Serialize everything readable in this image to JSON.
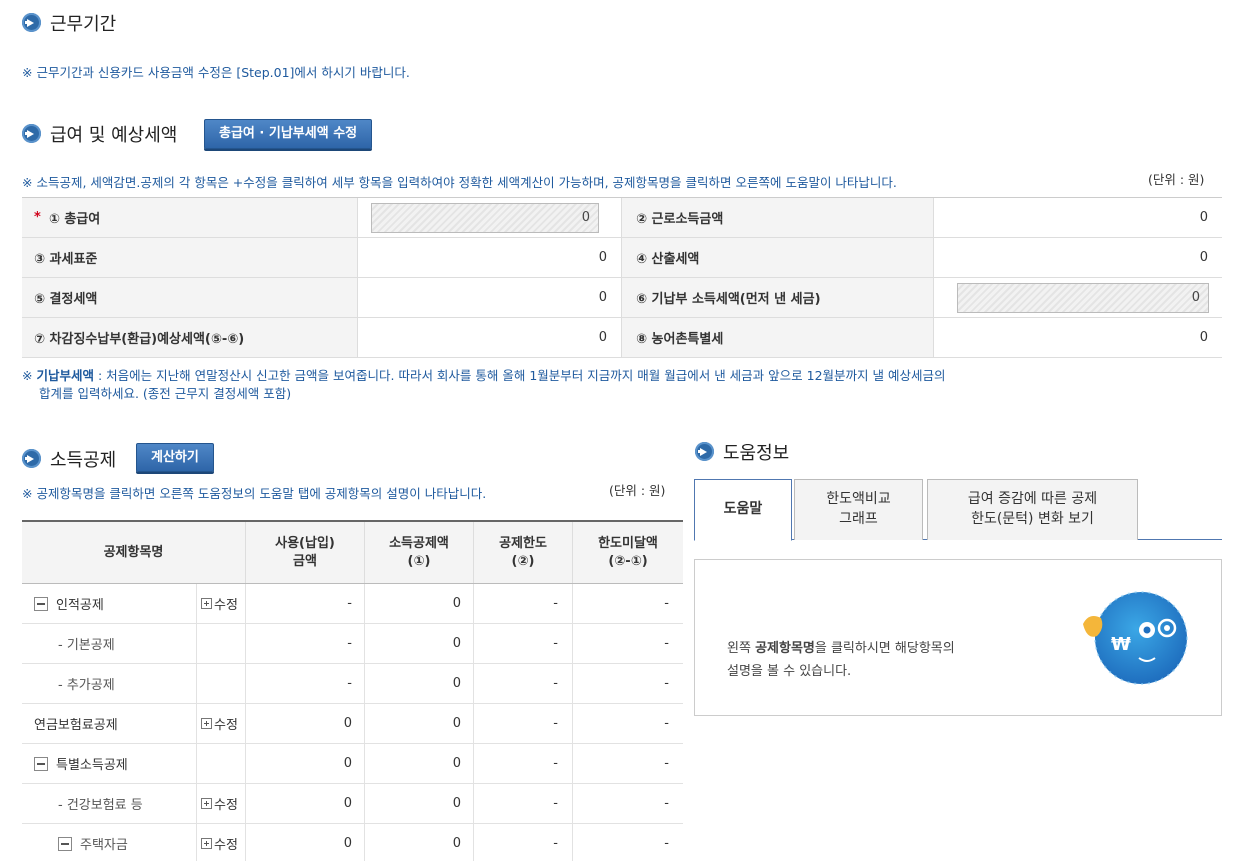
{
  "section1": {
    "title": "근무기간",
    "note": "※ 근무기간과 신용카드 사용금액 수정은 [Step.01]에서 하시기 바랍니다."
  },
  "section2": {
    "title": "급여 및 예상세액",
    "button": "총급여 · 기납부세액 수정",
    "note": "※ 소득공제, 세액감면.공제의 각 항목은 +수정을 클릭하여 세부 항목을 입력하여야 정확한 세액계산이 가능하며, 공제항목명을 클릭하면 오른쪽에 도움말이 나타납니다.",
    "unit": "(단위 : 원)",
    "rows": [
      {
        "l1": "① 총급여",
        "v1": "0",
        "l2": "② 근로소득금액",
        "v2": "0"
      },
      {
        "l1": "③ 과세표준",
        "v1": "0",
        "l2": "④ 산출세액",
        "v2": "0"
      },
      {
        "l1": "⑤ 결정세액",
        "v1": "0",
        "l2": "⑥ 기납부 소득세액(먼저 낸 세금)",
        "v2": "0"
      },
      {
        "l1": "⑦ 차감징수납부(환급)예상세액(⑤-⑥)",
        "v1": "0",
        "l2": "⑧ 농어촌특별세",
        "v2": "0"
      }
    ],
    "required_mark": "*",
    "footnote_label": "기납부세액",
    "footnote_prefix": "※",
    "footnote_line1": " : 처음에는 지난해 연말정산시 신고한 금액을 보여줍니다. 따라서 회사를 통해 올해 1월분부터 지금까지 매월 월급에서 낸 세금과 앞으로 12월분까지 낼 예상세금의",
    "footnote_line2": "합계를 입력하세요. (종전 근무지 결정세액 포함)"
  },
  "section3": {
    "title": "소득공제",
    "button": "계산하기",
    "note": "※ 공제항목명을 클릭하면 오른쪽 도움정보의 도움말 탭에 공제항목의 설명이 나타납니다.",
    "unit": "(단위 : 원)",
    "headers": {
      "item": "공제항목명",
      "used_1": "사용(납입)",
      "used_2": "금액",
      "ded_1": "소득공제액",
      "ded_2": "(①)",
      "limit_1": "공제한도",
      "limit_2": "(②)",
      "short_1": "한도미달액",
      "short_2": "(②-①)"
    },
    "edit_label": "수정",
    "rows": [
      {
        "name": "인적공제",
        "used": "-",
        "ded": "0",
        "limit": "-",
        "short": "-"
      },
      {
        "name": "- 기본공제",
        "used": "-",
        "ded": "0",
        "limit": "-",
        "short": "-"
      },
      {
        "name": "- 추가공제",
        "used": "-",
        "ded": "0",
        "limit": "-",
        "short": "-"
      },
      {
        "name": "연금보험료공제",
        "used": "0",
        "ded": "0",
        "limit": "-",
        "short": "-"
      },
      {
        "name": "특별소득공제",
        "used": "0",
        "ded": "0",
        "limit": "-",
        "short": "-"
      },
      {
        "name": "- 건강보험료 등",
        "used": "0",
        "ded": "0",
        "limit": "-",
        "short": "-"
      },
      {
        "name": "주택자금",
        "used": "0",
        "ded": "0",
        "limit": "-",
        "short": "-"
      }
    ]
  },
  "help": {
    "title": "도움정보",
    "tabs": [
      {
        "l1": "도움말",
        "l2": ""
      },
      {
        "l1": "한도액비교",
        "l2": "그래프"
      },
      {
        "l1": "급여 증감에 따른 공제",
        "l2": "한도(문턱) 변화 보기"
      }
    ],
    "text_prefix": "왼쪽 ",
    "text_bold": "공제항목명",
    "text_suffix": "을 클릭하시면 해당항목의",
    "text_line2": "설명을 볼 수 있습니다.",
    "mascot_symbol": "₩"
  }
}
